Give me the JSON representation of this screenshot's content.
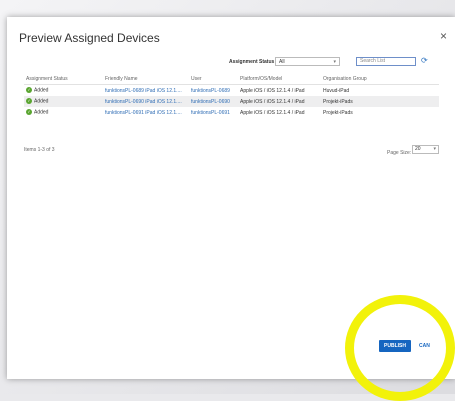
{
  "dialog": {
    "title": "Preview Assigned Devices",
    "close_icon": "×"
  },
  "filter": {
    "label": "Assignment Status",
    "selected": "All",
    "search_placeholder": "Search List"
  },
  "table": {
    "headers": [
      "Assignment Status",
      "Friendly Name",
      "User",
      "Platform/OS/Model",
      "Organisation Group"
    ],
    "rows": [
      {
        "status": "Added",
        "friendly_name": "funktionsPL-0689 iPad iOS 12.1....",
        "user": "funktionsPL-0689",
        "platform": "Apple iOS / iOS 12.1.4 / iPad",
        "group": "Huvud-iPad"
      },
      {
        "status": "Added",
        "friendly_name": "funktionsPL-0690 iPad iOS 12.1....",
        "user": "funktionsPL-0690",
        "platform": "Apple iOS / iOS 12.1.4 / iPad",
        "group": "Projekt-iPads"
      },
      {
        "status": "Added",
        "friendly_name": "funktionsPL-0691 iPad iOS 12.1....",
        "user": "funktionsPL-0691",
        "platform": "Apple iOS / iOS 12.1.4 / iPad",
        "group": "Projekt-iPads"
      }
    ]
  },
  "footer": {
    "items_count": "Items 1-3 of 3",
    "page_size_label": "Page Size:",
    "page_size_value": "20"
  },
  "actions": {
    "publish_label": "PUBLISH",
    "cancel_label": "CAN"
  },
  "colors": {
    "accent": "#1565c0",
    "success": "#5aa530",
    "highlight": "#f2f20a"
  }
}
